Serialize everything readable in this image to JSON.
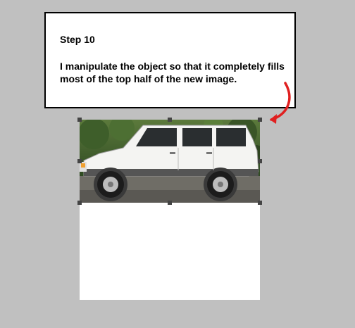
{
  "callout": {
    "title": "Step 10",
    "body": "I manipulate the object so that it completely fills most of the top half of the new image."
  },
  "colors": {
    "background": "#c0c0c0",
    "arrow": "#e02020",
    "canvas": "#ffffff",
    "vehicle_body": "#f4f4f2",
    "vehicle_trim": "#555555"
  },
  "icons": {
    "arrow": "curved-arrow-icon"
  }
}
